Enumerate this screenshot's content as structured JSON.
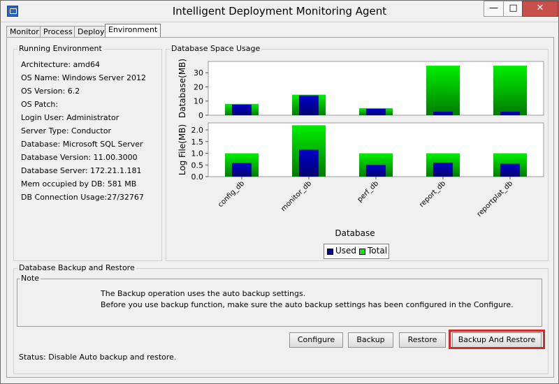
{
  "window": {
    "title": "Intelligent Deployment Monitoring Agent",
    "min_label": "—",
    "max_label": "□",
    "close_label": "✕"
  },
  "tabs": [
    {
      "label": "Monitor"
    },
    {
      "label": "Process"
    },
    {
      "label": "Deploy"
    },
    {
      "label": "Environment"
    }
  ],
  "running_env": {
    "title": "Running Environment",
    "lines": [
      "Architecture: amd64",
      "OS Name: Windows Server 2012",
      "OS Version: 6.2",
      "OS Patch:",
      "Login User: Administrator",
      "Server Type: Conductor",
      "Database: Microsoft SQL Server",
      "Database Version: 11.00.3000",
      "Database Server: 172.21.1.181",
      "Mem occupied by DB: 581 MB",
      "DB Connection Usage:27/32767"
    ]
  },
  "db_space": {
    "title": "Database Space Usage"
  },
  "chart_data": {
    "type": "bar",
    "xlabel": "Database",
    "categories": [
      "config_db",
      "monitor_db",
      "perf_db",
      "report_db",
      "reportplat_db"
    ],
    "panels": [
      {
        "ylabel": "Database(MB)",
        "ylim": [
          0,
          38
        ],
        "yticks": [
          0,
          10,
          20,
          30
        ],
        "series": [
          {
            "name": "Used",
            "values": [
              7.5,
              14,
              4.5,
              2.5,
              2.5
            ]
          },
          {
            "name": "Total",
            "values": [
              8,
              14.5,
              5,
              35,
              35
            ]
          }
        ]
      },
      {
        "ylabel": "Log File(MB)",
        "ylim": [
          0,
          2.3
        ],
        "yticks": [
          0.0,
          0.5,
          1.0,
          1.5,
          2.0
        ],
        "ytick_labels": [
          "0.0",
          "0.5",
          "1.0",
          "1.5",
          "2.0"
        ],
        "series": [
          {
            "name": "Used",
            "values": [
              0.58,
              1.15,
              0.5,
              0.6,
              0.55
            ]
          },
          {
            "name": "Total",
            "values": [
              1.0,
              2.2,
              1.0,
              1.0,
              1.0
            ]
          }
        ]
      }
    ],
    "legend": {
      "placement": "bottom-right",
      "items": [
        "Used",
        "Total"
      ]
    },
    "colors": {
      "used": "#0000aa",
      "total": "#00ee00"
    }
  },
  "backup": {
    "title": "Database Backup and Restore",
    "note_title": "Note",
    "note_lines": [
      "The Backup operation uses the auto backup settings.",
      "Before you use backup function, make sure the auto backup settings has been configured in the Configure."
    ],
    "buttons": {
      "configure": "Configure",
      "backup": "Backup",
      "restore": "Restore",
      "backup_and_restore": "Backup And Restore"
    },
    "status": "Status: Disable Auto backup and restore."
  }
}
